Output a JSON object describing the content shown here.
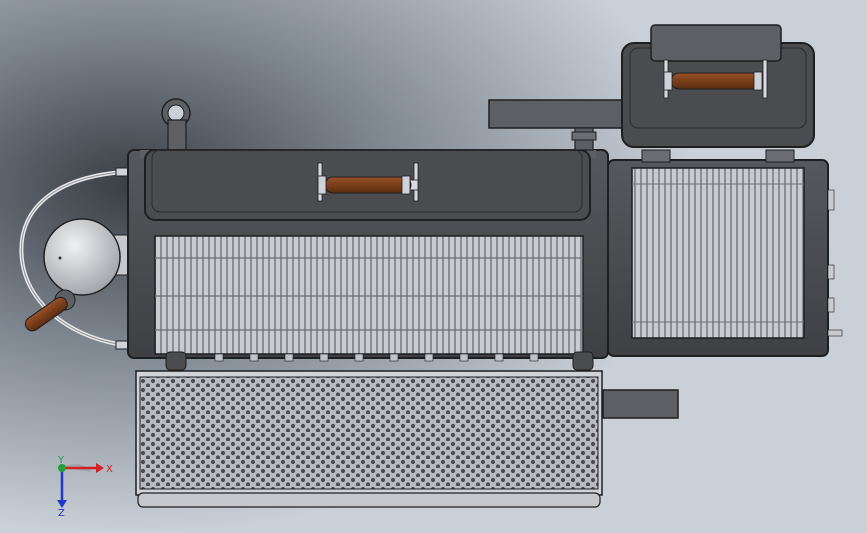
{
  "viewport": {
    "background_light": "#c9d0d8",
    "background_dark": "#3a3f45"
  },
  "model": {
    "metal_dark": "#4a4c50",
    "metal_mid": "#5c5f63",
    "metal_light": "#7a7d82",
    "grate_color": "#c8cbd0",
    "grate_shadow": "#8a8e94",
    "handle_wood": "#7a3e1a",
    "handle_wood_light": "#9a5228",
    "steel_light": "#d8dadd",
    "perforated_plate": "#b8bcc2",
    "perforation": "#4a4d52",
    "outline": "#1e1f21"
  },
  "triad": {
    "x_label": "X",
    "y_label": "Y",
    "z_label": "Z",
    "x_color": "#d42020",
    "y_color": "#1fa23a",
    "z_color": "#2038c8"
  }
}
